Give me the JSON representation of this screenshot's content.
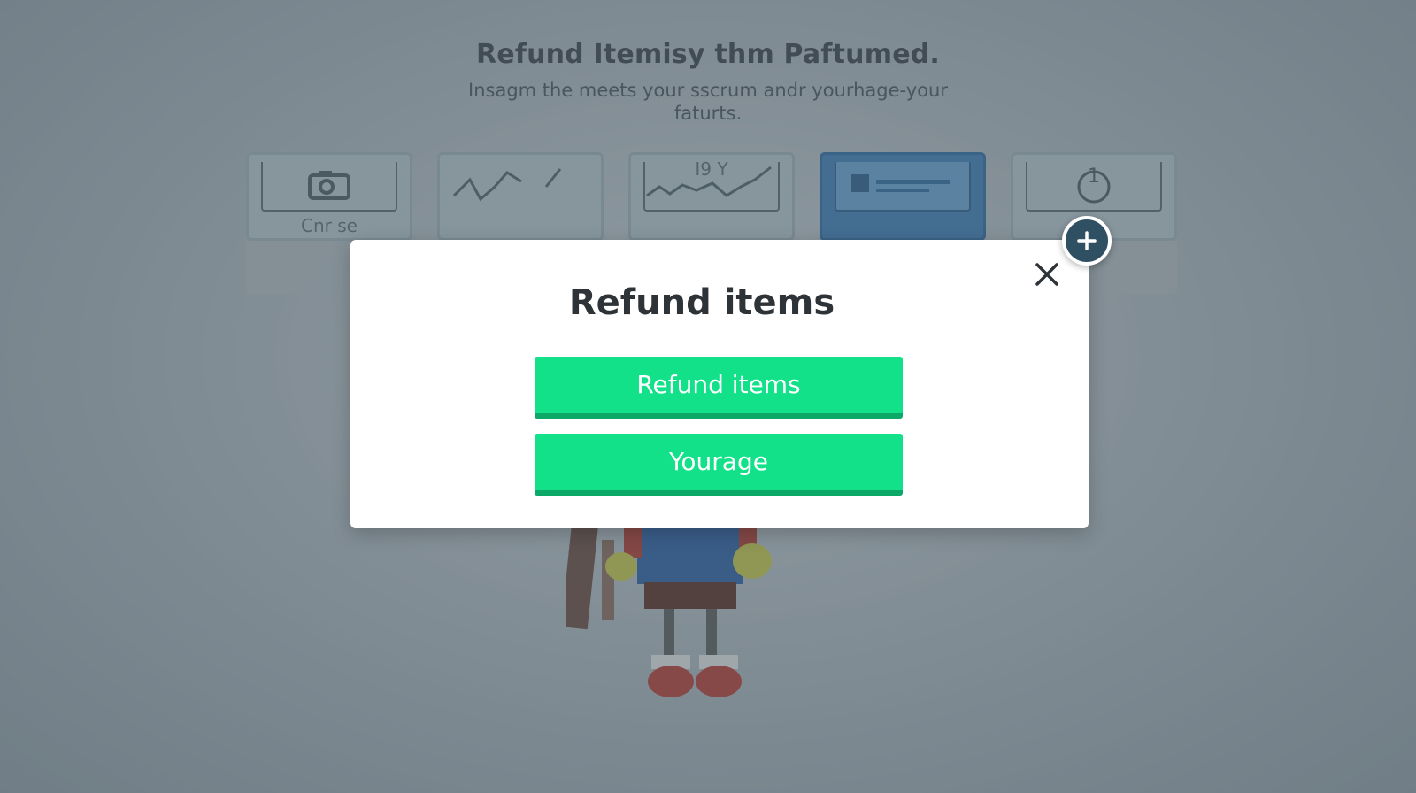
{
  "background": {
    "title": "Refund Itemisy thm Paftumed.",
    "subtitle": "Insagm the meets your sscrum andr yourhage-your faturts.",
    "cards": [
      {
        "label": "Cnr se",
        "icon": "camera-icon"
      },
      {
        "label": "",
        "icon": "line-chart-icon"
      },
      {
        "label": "I9 Y",
        "icon": "line-chart-icon"
      },
      {
        "label": "",
        "icon": "app-window-icon"
      },
      {
        "label": "1",
        "icon": "number-one-icon"
      }
    ]
  },
  "modal": {
    "title": "Refund items",
    "primary_button": "Refund items",
    "secondary_button": "Yourage",
    "close_icon": "close-icon",
    "badge_icon": "plus-icon"
  },
  "colors": {
    "button": "#12e18a",
    "button_shadow": "#0ba868",
    "badge": "#2f4f63"
  }
}
